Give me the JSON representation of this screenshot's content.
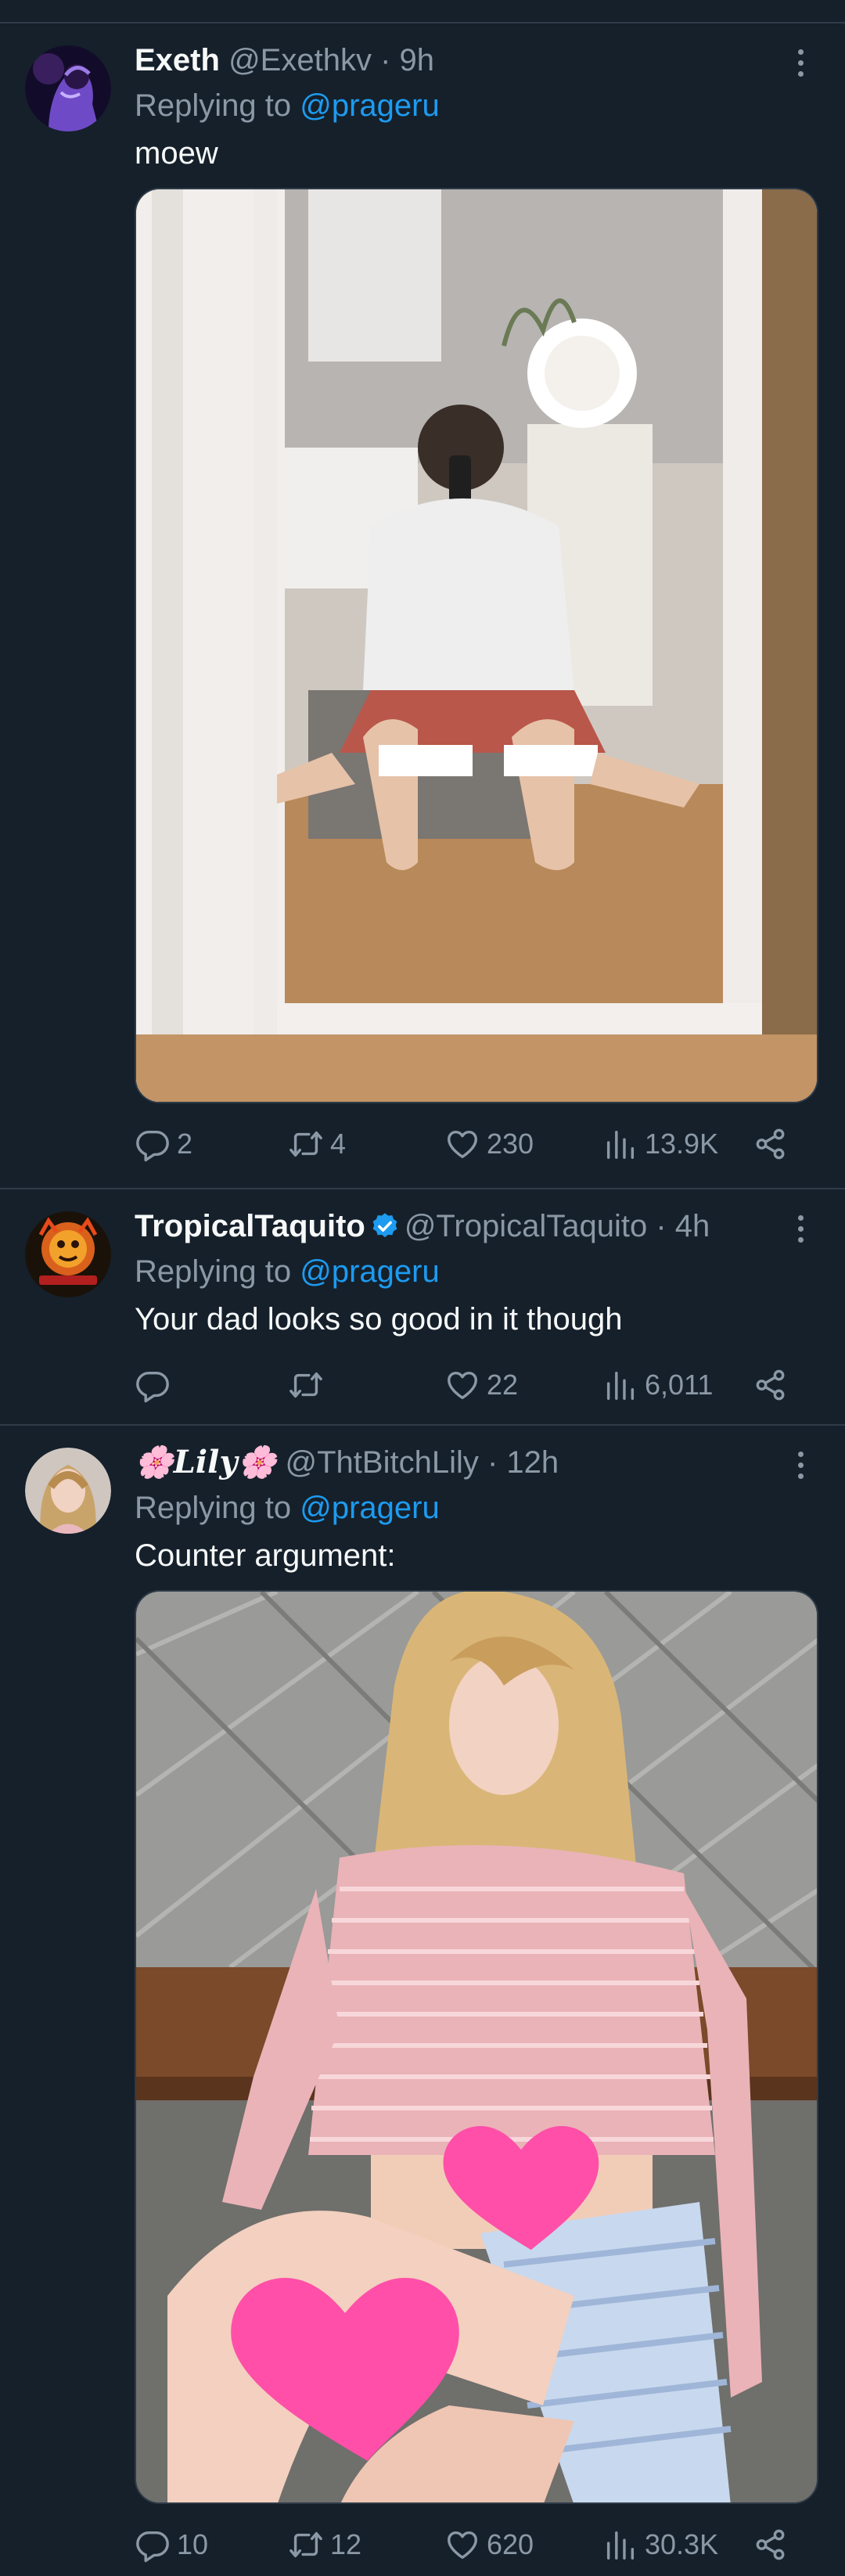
{
  "replies": [
    {
      "display_name": "Exeth",
      "handle": "@Exethkv",
      "time": "9h",
      "replying_prefix": "Replying to",
      "replying_to": "@prageru",
      "text": "moew",
      "verified": false,
      "stats": {
        "replies": "2",
        "retweets": "4",
        "likes": "230",
        "views": "13.9K"
      }
    },
    {
      "display_name": "TropicalTaquito",
      "handle": "@TropicalTaquito",
      "time": "4h",
      "replying_prefix": "Replying to",
      "replying_to": "@prageru",
      "text": "Your dad looks so good in it though",
      "verified": true,
      "stats": {
        "replies": "",
        "retweets": "",
        "likes": "22",
        "views": "6,011"
      }
    },
    {
      "display_name": "🌸Lily🌸",
      "handle": "@ThtBitchLily",
      "time": "12h",
      "replying_prefix": "Replying to",
      "replying_to": "@prageru",
      "text": "Counter argument:",
      "verified": false,
      "stats": {
        "replies": "10",
        "retweets": "12",
        "likes": "620",
        "views": "30.3K"
      }
    }
  ],
  "separator": "·",
  "colors": {
    "background": "#15202b",
    "text": "#f7f9f9",
    "muted": "#8b98a5",
    "link": "#1d9bf0",
    "verified": "#1d9bf0",
    "divider": "#2f3b47",
    "heart_emoji": "#ff4fa8"
  },
  "icons": {
    "reply": "speech-bubble-icon",
    "retweet": "retweet-icon",
    "like": "heart-icon",
    "views": "bar-chart-icon",
    "share": "share-icon",
    "more": "more-options-icon",
    "verified": "verified-badge-icon"
  }
}
